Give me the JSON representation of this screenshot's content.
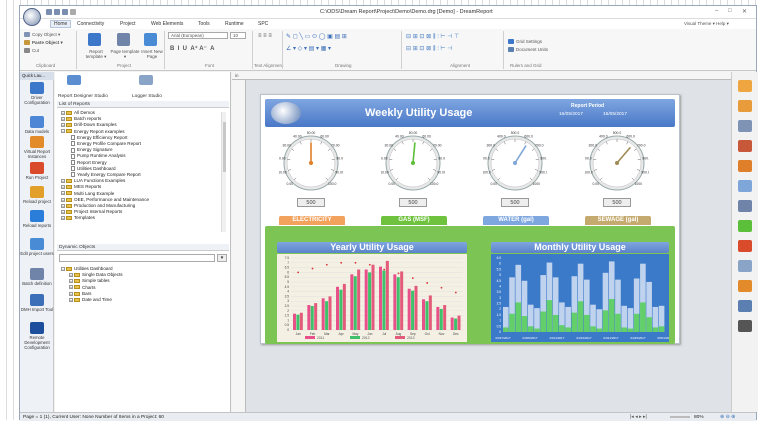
{
  "window": {
    "title": "C:\\ODS\\Dream Report\\Project\\Demo\\Demo.drg [Demo] - DreamReport",
    "right_label": "Visual Theme ▾  Help ▾"
  },
  "menu": [
    "Home",
    "Connectivity",
    "Project",
    "Web Elements",
    "Tools",
    "Runtime",
    "SPC"
  ],
  "ribbon": {
    "clipboard": {
      "copy": "Copy Object ▾",
      "paste": "Paste Object ▾",
      "cut": "Cut",
      "group": "Clipboard"
    },
    "project": {
      "report": "Report template ▾",
      "page": "Page template ▾",
      "insert": "Insert New Page",
      "group": "Project"
    },
    "font": {
      "family": "Arial (European)",
      "size": "10",
      "group": "Font"
    },
    "text_alignment": "Text Alignment",
    "drawing": "Drawing",
    "alignment": "Alignment",
    "rulers": {
      "grid": "Grid Settings",
      "units": "Document Units",
      "group": "Rulers and Grid"
    }
  },
  "leftnav": [
    {
      "label": "Driver Configuration",
      "color": "#3d77c9"
    },
    {
      "label": "Data models",
      "color": "#4c86d4"
    },
    {
      "label": "Virtual Report Instances",
      "color": "#e38b2b"
    },
    {
      "label": "Run Project",
      "color": "#d94b2b"
    },
    {
      "label": "Reload project",
      "color": "#e2a02a"
    },
    {
      "label": "Reload reports",
      "color": "#2a7ed9"
    },
    {
      "label": "Edit project users",
      "color": "#4a8bd6"
    },
    {
      "label": "Batch definition",
      "color": "#6f84a8"
    },
    {
      "label": "DMH Import Tool",
      "color": "#3d6fb8"
    },
    {
      "label": "Remote Development Configuration",
      "color": "#1e4f9c"
    }
  ],
  "quicklaunch": "Quick Lau...",
  "panel": {
    "tabs": [
      "Report Designer Studio",
      "Logger Studio"
    ],
    "list_header": "List of Reports",
    "reports": [
      {
        "label": "All Demos",
        "indent": 0,
        "type": "folder"
      },
      {
        "label": "Batch reports",
        "indent": 0,
        "type": "folder"
      },
      {
        "label": "Drill-Down Examples",
        "indent": 0,
        "type": "folder"
      },
      {
        "label": "Energy Report examples",
        "indent": 0,
        "type": "folder-open"
      },
      {
        "label": "Energy Efficiency Report",
        "indent": 1,
        "type": "doc"
      },
      {
        "label": "Energy Profile Compare Report",
        "indent": 1,
        "type": "doc"
      },
      {
        "label": "Energy Signature",
        "indent": 1,
        "type": "doc"
      },
      {
        "label": "Pump Runtime Analysis",
        "indent": 1,
        "type": "doc"
      },
      {
        "label": "Report Energy",
        "indent": 1,
        "type": "doc"
      },
      {
        "label": "Utilities Dashboard",
        "indent": 1,
        "type": "doc"
      },
      {
        "label": "Yearly Energy Compare Report",
        "indent": 1,
        "type": "doc"
      },
      {
        "label": "LUA Functions Examples",
        "indent": 0,
        "type": "folder"
      },
      {
        "label": "MES Reports",
        "indent": 0,
        "type": "folder"
      },
      {
        "label": "Multi Lang Example",
        "indent": 0,
        "type": "folder"
      },
      {
        "label": "OEE, Performance and Maintenance",
        "indent": 0,
        "type": "folder"
      },
      {
        "label": "Production and Manufacturing",
        "indent": 0,
        "type": "folder"
      },
      {
        "label": "Project Internal Reports",
        "indent": 0,
        "type": "folder"
      },
      {
        "label": "Templates",
        "indent": 0,
        "type": "folder"
      }
    ],
    "dyn_header": "Dynamic Objects",
    "dyn_tree": [
      {
        "label": "Utilities Dashboard",
        "indent": 0
      },
      {
        "label": "Single Data Objects",
        "indent": 1
      },
      {
        "label": "Simple tables",
        "indent": 1
      },
      {
        "label": "Charts",
        "indent": 1
      },
      {
        "label": "Bars",
        "indent": 1
      },
      {
        "label": "Date and Time",
        "indent": 1
      }
    ]
  },
  "report": {
    "title": "Weekly Utility Usage",
    "period_label": "Report Period",
    "period_from": "16/05/2017",
    "period_to": "16/05/2017",
    "gauges": [
      {
        "min": "0.00",
        "max": "100.0",
        "value_display": "500",
        "ticks": [
          "10.00",
          "20.00",
          "30.00",
          "40.00",
          "50.00",
          "60.00",
          "70.00",
          "80.00",
          "90.00"
        ],
        "needle_frac": 0.5,
        "color": "#e07f2a"
      },
      {
        "min": "0.00",
        "max": "100.0",
        "value_display": "500",
        "ticks": [
          "10.00",
          "20.00",
          "30.00",
          "40.00",
          "50.00",
          "60.00",
          "70.00",
          "80.00",
          "90.00"
        ],
        "needle_frac": 0.52,
        "color": "#5cbf3a"
      },
      {
        "min": "0.00",
        "max": "1000",
        "value_display": "500",
        "ticks": [
          "100.0",
          "200.0",
          "300.0",
          "400.0",
          "500.0",
          "600.0",
          "700.0",
          "800.0",
          "900.0"
        ],
        "needle_frac": 0.62,
        "color": "#7fa6d8"
      },
      {
        "min": "0.00",
        "max": "1000",
        "value_display": "500",
        "ticks": [
          "100.0",
          "200.0",
          "300.0",
          "400.0",
          "500.0",
          "600.0",
          "700.0",
          "800.0",
          "900.0"
        ],
        "needle_frac": 0.65,
        "color": "#a08a55"
      }
    ],
    "tabs": [
      {
        "label": "ELECTRICITY",
        "color": "#f2a25c"
      },
      {
        "label": "GAS (MSF)",
        "color": "#6fc23e"
      },
      {
        "label": "WATER (gal)",
        "color": "#7ea7e0"
      },
      {
        "label": "SEWAGE (gal)",
        "color": "#c4aa6e"
      }
    ],
    "yearly": {
      "title": "Yearly Utility Usage",
      "legend": [
        "2011",
        "2012",
        "2013"
      ]
    },
    "monthly": {
      "title": "Monthly Utility Usage"
    }
  },
  "chart_data": [
    {
      "type": "bar",
      "title": "Yearly Utility Usage",
      "categories": [
        "Jan",
        "Feb",
        "Mar",
        "Apr",
        "May",
        "Jun",
        "Jul",
        "Aug",
        "Sep",
        "Oct",
        "Nov",
        "Dec"
      ],
      "yticks": [
        "0",
        "0.5",
        "1",
        "1.5",
        "2",
        "2.5",
        "3",
        "3.5",
        "4",
        "4.5",
        "5",
        "5.5",
        "6",
        "6.5",
        "7",
        "7.5"
      ],
      "ylim": [
        0,
        7.5
      ],
      "series": [
        {
          "name": "2011",
          "values": [
            1.7,
            2.6,
            3.3,
            4.5,
            5.8,
            6.3,
            6.6,
            5.8,
            4.3,
            3.2,
            2.4,
            1.3
          ],
          "color": "#e8508a"
        },
        {
          "name": "2012",
          "values": [
            1.6,
            2.5,
            3.0,
            4.2,
            5.6,
            6.0,
            6.2,
            5.5,
            4.1,
            3.0,
            2.2,
            1.2
          ],
          "color": "#3fc16b"
        },
        {
          "name": "2013",
          "values": [
            1.8,
            2.8,
            3.5,
            4.8,
            6.3,
            6.8,
            7.2,
            6.1,
            4.6,
            3.6,
            2.6,
            1.5
          ],
          "color": "#e35a7a"
        }
      ],
      "line": {
        "values": [
          6.0,
          6.4,
          6.8,
          7.0,
          7.0,
          6.8,
          6.3,
          5.9,
          5.4,
          4.9,
          4.4,
          3.9
        ],
        "color": "#d83232"
      }
    },
    {
      "type": "area",
      "title": "Monthly Utility Usage",
      "categories": [
        "03/27/2017",
        "04/06/2017",
        "04/11/2017",
        "04/16/2017",
        "04/21/2017",
        "04/26/2017",
        "05/01/2017"
      ],
      "yticks": [
        "0",
        "0.5",
        "1",
        "1.5",
        "2",
        "2.5",
        "3",
        "3.5",
        "4",
        "4.5",
        "5",
        "5.5",
        "6",
        "6.5"
      ],
      "series": [
        {
          "name": "",
          "color": "#bfd3ee",
          "values": [
            2.2,
            4.8,
            5.9,
            4.5,
            2.4,
            2.1,
            5.0,
            6.1,
            4.8,
            2.6,
            2.2,
            4.9,
            6.0,
            4.6,
            2.4,
            2.0,
            5.2,
            6.2,
            4.6,
            2.3,
            2.1,
            4.7,
            6.0,
            4.4,
            2.2,
            2.3
          ]
        },
        {
          "name": "",
          "color": "#63cf6b",
          "values": [
            0.4,
            1.6,
            2.6,
            1.4,
            0.5,
            0.3,
            1.8,
            2.8,
            1.5,
            0.6,
            0.4,
            1.7,
            2.7,
            1.5,
            0.5,
            0.3,
            1.9,
            2.9,
            1.6,
            0.4,
            0.3,
            1.6,
            2.6,
            1.3,
            0.4,
            0.5
          ]
        }
      ]
    }
  ],
  "rightbar_icons": [
    "report-icon",
    "folder-icon",
    "table-icon",
    "chart-icon",
    "image-icon",
    "grid-icon",
    "text-icon",
    "bar-chart-icon",
    "pie-chart-icon",
    "gauge-icon",
    "stack-icon",
    "settings-icon",
    "tools-icon"
  ],
  "status": {
    "left": "Page = 1 (1), Current User: None   Number of Items in a Project: 60",
    "zoom": "80%"
  }
}
